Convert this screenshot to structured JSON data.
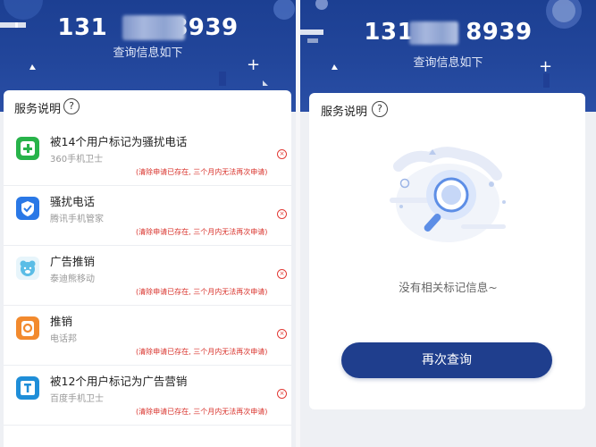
{
  "left_panel": {
    "phone": "131",
    "phone_tail": "8939",
    "subtitle": "查询信息如下",
    "section_title": "服务说明",
    "help_icon": "?",
    "items": [
      {
        "icon": "360-icon",
        "label": "被14个用户标记为骚扰电话",
        "source": "360手机卫士",
        "note": "(清除申请已存在, 三个月内无法再次申请)"
      },
      {
        "icon": "tencent-shield-icon",
        "label": "骚扰电话",
        "source": "腾讯手机管家",
        "note": "(清除申请已存在, 三个月内无法再次申请)"
      },
      {
        "icon": "teddy-bear-icon",
        "label": "广告推销",
        "source": "泰迪熊移动",
        "note": "(清除申请已存在, 三个月内无法再次申请)"
      },
      {
        "icon": "phone-bang-icon",
        "label": "推销",
        "source": "电话邦",
        "note": "(清除申请已存在, 三个月内无法再次申请)"
      },
      {
        "icon": "baidu-shield-icon",
        "label": "被12个用户标记为广告营销",
        "source": "百度手机卫士",
        "note": "(清除申请已存在, 三个月内无法再次申请)"
      }
    ]
  },
  "right_panel": {
    "phone": "131",
    "phone_tail": "8939",
    "subtitle": "查询信息如下",
    "section_title": "服务说明",
    "help_icon": "?",
    "empty_text": "没有相关标记信息~",
    "retry_button": "再次查询"
  }
}
